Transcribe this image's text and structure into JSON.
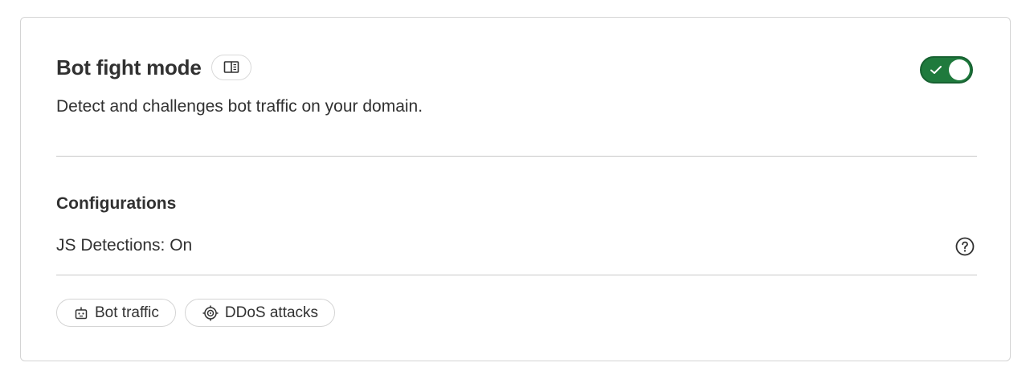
{
  "card": {
    "title": "Bot fight mode",
    "docs_icon": "book-open-icon",
    "description": "Detect and challenges bot traffic on your domain.",
    "toggle": {
      "state": "on",
      "icon": "check-icon",
      "color": "#1f7a3d"
    }
  },
  "configurations": {
    "heading": "Configurations",
    "js_detections": "JS Detections: On",
    "help_icon": "question-circle-icon"
  },
  "tags": [
    {
      "label": "Bot traffic",
      "icon": "robot-icon"
    },
    {
      "label": "DDoS attacks",
      "icon": "target-icon"
    }
  ]
}
